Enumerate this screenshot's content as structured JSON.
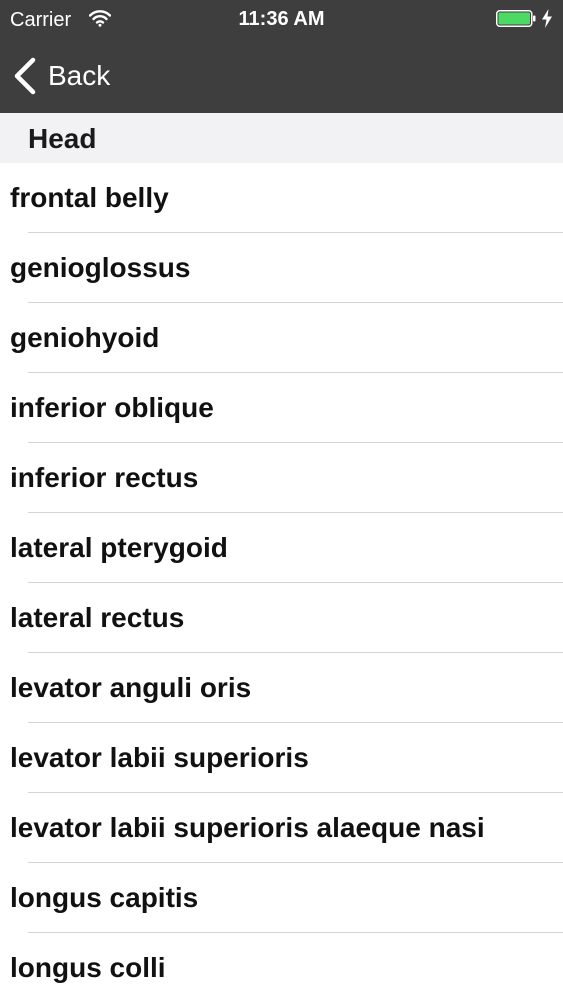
{
  "status_bar": {
    "carrier": "Carrier",
    "time": "11:36 AM",
    "battery_level": 1.0,
    "battery_color": "#4cd964",
    "icons": [
      "wifi-icon",
      "battery-icon",
      "charging-bolt-icon"
    ]
  },
  "nav": {
    "back_label": "Back",
    "back_icon": "chevron-left-icon"
  },
  "section": {
    "title": "Head"
  },
  "items": [
    "frontal belly",
    "genioglossus",
    "geniohyoid",
    "inferior oblique",
    "inferior rectus",
    "lateral pterygoid",
    "lateral rectus",
    "levator anguli oris",
    "levator labii superioris",
    "levator labii superioris alaeque nasi",
    "longus capitis",
    "longus colli"
  ],
  "colors": {
    "navbar_bg": "#3e3e3e",
    "section_bg": "#f2f2f4",
    "separator": "#d4d4d8"
  }
}
